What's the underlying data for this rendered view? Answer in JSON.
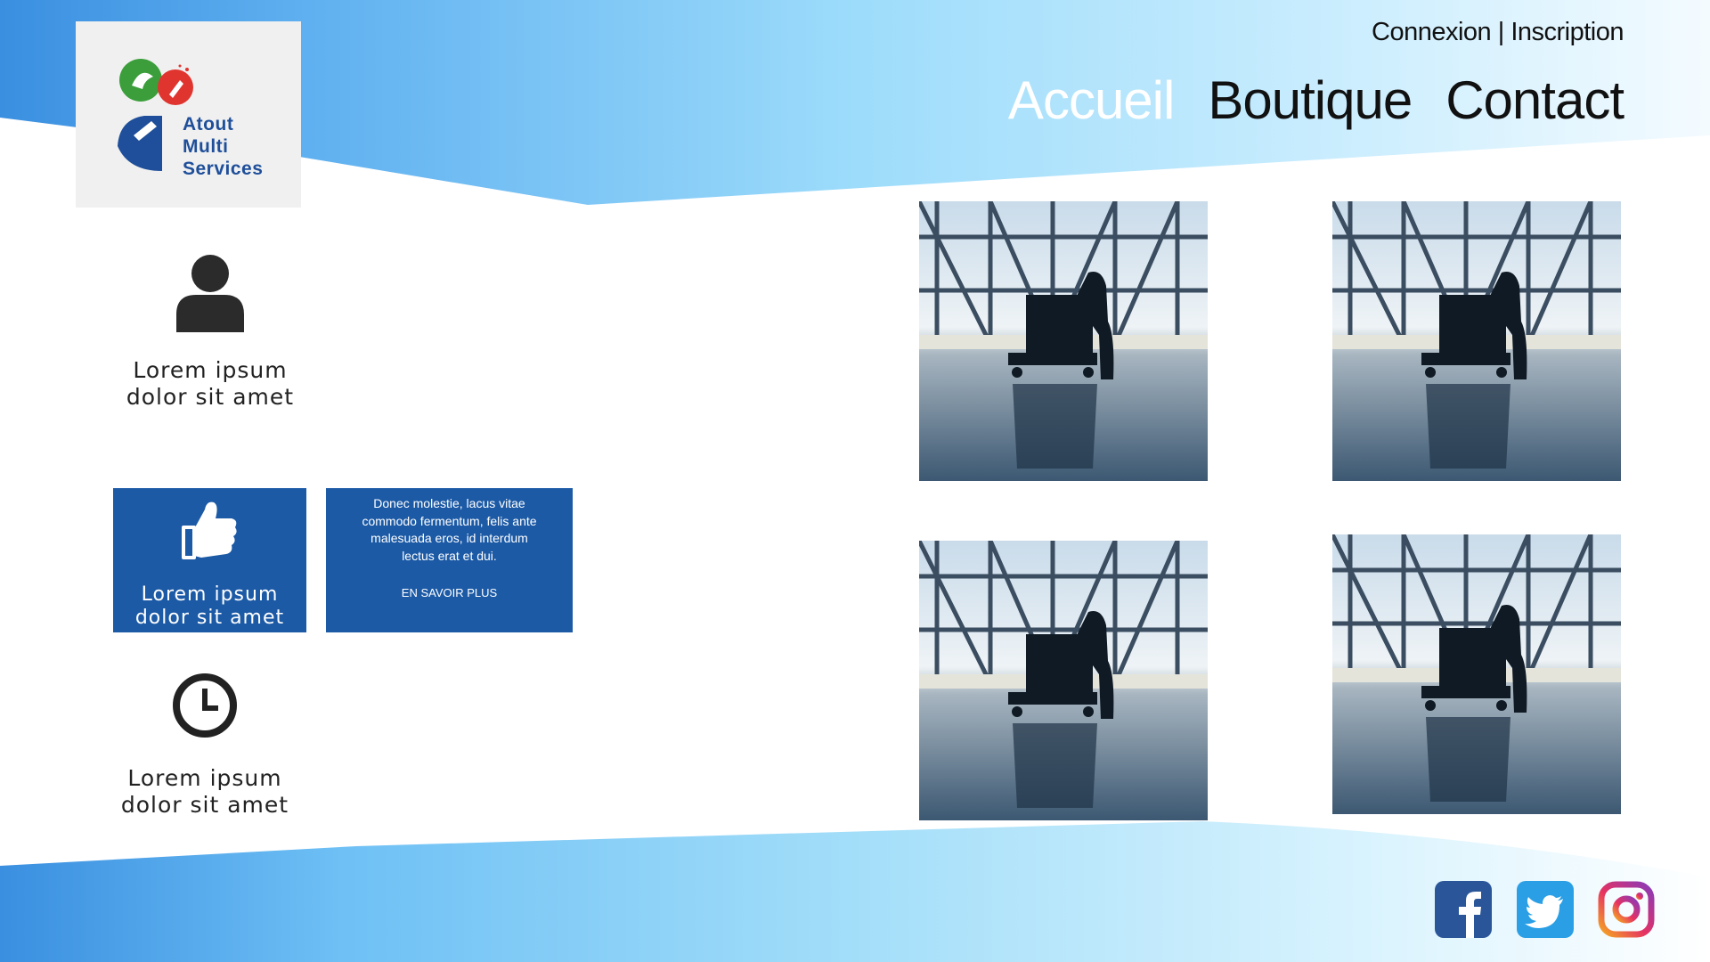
{
  "brand": {
    "logo_line1": "Atout",
    "logo_line2": "Multi",
    "logo_line3": "Services"
  },
  "header": {
    "login": "Connexion",
    "separator": "|",
    "register": "Inscription",
    "nav": [
      "Accueil",
      "Boutique",
      "Contact"
    ],
    "active_nav": "Accueil"
  },
  "features": [
    {
      "icon": "user-icon",
      "label_line1": "Lorem ipsum",
      "label_line2": "dolor sit amet"
    },
    {
      "icon": "thumbs-up-icon",
      "label_line1": "Lorem ipsum",
      "label_line2": "dolor sit amet"
    },
    {
      "icon": "clock-icon",
      "label_line1": "Lorem ipsum",
      "label_line2": "dolor sit amet"
    }
  ],
  "info_card": {
    "text": "Donec molestie, lacus vitae commodo fermentum, felis ante malesuada eros, id interdum lectus erat et dui.",
    "cta": "EN SAVOIR PLUS"
  },
  "gallery": [
    {
      "icon": "cleaning-worker-photo"
    },
    {
      "icon": "cleaning-worker-photo"
    },
    {
      "icon": "cleaning-worker-photo"
    },
    {
      "icon": "cleaning-worker-photo"
    }
  ],
  "social": [
    "facebook-icon",
    "twitter-icon",
    "instagram-icon"
  ],
  "colors": {
    "accent_blue": "#1c5aa6",
    "gradient_start": "#3a8fe0",
    "gradient_end": "#ffffff",
    "logo_green": "#3b9e3b",
    "logo_red": "#e0342f",
    "logo_blue": "#1f4f9a"
  }
}
